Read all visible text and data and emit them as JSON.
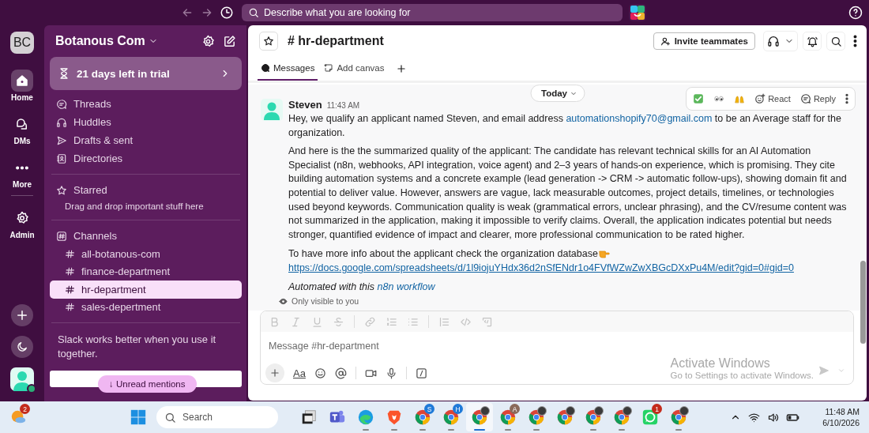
{
  "topbar": {
    "search_placeholder": "Describe what you are looking for"
  },
  "rail": {
    "workspace_initials": "BC",
    "items": [
      {
        "kind": "home",
        "label": "Home",
        "selected": true
      },
      {
        "kind": "dms",
        "label": "DMs",
        "selected": false
      },
      {
        "kind": "more",
        "label": "More",
        "selected": false
      },
      {
        "kind": "admin",
        "label": "Admin",
        "selected": false
      }
    ]
  },
  "sidebar": {
    "workspace": "Botanous Com",
    "trial": "21 days left in trial",
    "nav": [
      {
        "kind": "threads",
        "label": "Threads"
      },
      {
        "kind": "huddles",
        "label": "Huddles"
      },
      {
        "kind": "drafts",
        "label": "Drafts & sent"
      },
      {
        "kind": "directories",
        "label": "Directories"
      }
    ],
    "starred": {
      "title": "Starred",
      "hint": "Drag and drop important stuff here"
    },
    "channels": {
      "title": "Channels",
      "items": [
        {
          "name": "all-botanous-com",
          "selected": false
        },
        {
          "name": "finance-department",
          "selected": false
        },
        {
          "name": "hr-department",
          "selected": true
        },
        {
          "name": "sales-depertment",
          "selected": false
        }
      ]
    },
    "promo": "Slack works better when you use it together.",
    "unread_button": "↓ Unread mentions"
  },
  "channel": {
    "title": "# hr-department",
    "invite_button": "Invite teammates",
    "tabs": [
      {
        "kind": "messages",
        "label": "Messages",
        "selected": true
      },
      {
        "kind": "canvas",
        "label": "Add canvas",
        "selected": false
      }
    ],
    "date_divider": "Today",
    "hover_actions": {
      "react": "React",
      "reply": "Reply"
    },
    "message": {
      "author": "Steven",
      "time": "11:43 AM",
      "paragraphs": [
        {
          "italic": false,
          "parts": [
            {
              "kind": "text",
              "text": "Hey, we qualify an applicant named Steven, and email address "
            },
            {
              "kind": "link",
              "text": "automationshopify70@gmail.com"
            },
            {
              "kind": "text",
              "text": " to be an Average staff for the organization."
            }
          ]
        },
        {
          "italic": false,
          "parts": [
            {
              "kind": "text",
              "text": "And here is the the summarized quality of the applicant: The candidate has relevant technical skills for an AI Automation Specialist (n8n, webhooks, API integration, voice agent) and 2–3 years of hands-on experience, which is promising. They cite building automation systems and a concrete example (lead generation -> CRM -> automatic follow-ups), showing domain fit and potential to deliver value. However, answers are vague, lack measurable outcomes, project details, timelines, or technologies used beyond keywords. Communication quality is weak (grammatical errors, unclear phrasing), and the CV/resume content was not summarized in the application, making it impossible to verify claims. Overall, the application indicates potential but needs stronger, quantified evidence of impact and clearer, more professional communication to be rated higher."
            }
          ]
        },
        {
          "italic": false,
          "parts": [
            {
              "kind": "text",
              "text": "To have more info about the applicant check the organization database"
            },
            {
              "kind": "pointing-hand"
            },
            {
              "kind": "url",
              "text": "https://docs.google.com/spreadsheets/d/1l9iojuYHdx36d2nSfENdr1o4FVfWZwZwXBGcDXxPu4M/edit?gid=0#gid=0"
            }
          ]
        },
        {
          "italic": true,
          "parts": [
            {
              "kind": "text",
              "text": "Automated with this "
            },
            {
              "kind": "link",
              "text": "n8n workflow"
            }
          ]
        }
      ],
      "visibility": "Only visible to you"
    },
    "composer": {
      "placeholder": "Message #hr-department",
      "format_toggle": "Aa"
    }
  },
  "system_notice": {
    "title": "Activate Windows",
    "hint": "Go to Settings to activate Windows."
  },
  "taskbar": {
    "search_placeholder": "Search",
    "time": "11:48 AM",
    "date": "6/10/2026",
    "apps": [
      {
        "kind": "weather",
        "badge": "2",
        "running": false,
        "selected": false
      },
      {
        "kind": "start",
        "running": false,
        "selected": false
      },
      {
        "kind": "search"
      },
      {
        "kind": "taskview",
        "running": false,
        "selected": false
      },
      {
        "kind": "teams",
        "running": false,
        "selected": false
      },
      {
        "kind": "edge",
        "running": true,
        "selected": false
      },
      {
        "kind": "brave",
        "running": true,
        "selected": false
      },
      {
        "kind": "chrome",
        "badge": "S",
        "profile": false,
        "running": true,
        "selected": false
      },
      {
        "kind": "chrome",
        "badge": "H",
        "profile": false,
        "running": true,
        "selected": false
      },
      {
        "kind": "chrome",
        "profile": true,
        "running": true,
        "selected": true
      },
      {
        "kind": "chrome",
        "badge": "A",
        "profile": false,
        "running": true,
        "selected": false
      },
      {
        "kind": "chrome",
        "profile": true,
        "running": true,
        "selected": false
      },
      {
        "kind": "chrome",
        "profile": true,
        "running": false,
        "selected": false
      },
      {
        "kind": "chrome",
        "profile": true,
        "running": true,
        "selected": false
      },
      {
        "kind": "chrome",
        "profile": true,
        "running": true,
        "selected": false
      },
      {
        "kind": "whatsapp",
        "badge": "1",
        "running": false,
        "selected": false
      },
      {
        "kind": "chrome",
        "profile": true,
        "running": true,
        "selected": false
      }
    ]
  }
}
